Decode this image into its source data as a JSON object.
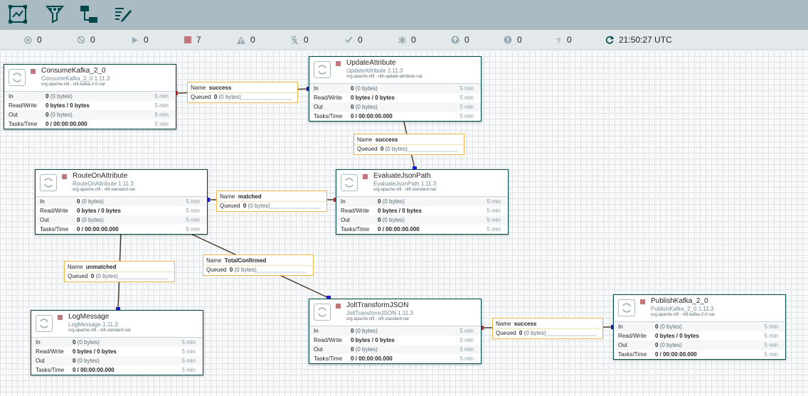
{
  "toolbar": {
    "buttons": [
      {
        "name": "navigate-icon"
      },
      {
        "name": "funnel-icon"
      },
      {
        "name": "connect-icon"
      },
      {
        "name": "edit-icon"
      }
    ]
  },
  "status": {
    "transmitting": "0",
    "not_transmitting": "0",
    "running": "0",
    "stopped": "7",
    "invalid": "0",
    "disabled": "0",
    "up_to_date": "0",
    "locally_modified": "0",
    "stale": "0",
    "sync_failure": "0",
    "unknown": "0",
    "time": "21:50:27 UTC"
  },
  "colors": {
    "stopped": "#c17679",
    "source_port": "#e62727",
    "dest_port": "#1b1bd5",
    "connection_border": "#f0b647",
    "processor_border": "#004849"
  },
  "processors": [
    {
      "id": "consume",
      "name": "ConsumeKafka_2_0",
      "type": "ConsumeKafka_2_0 1.11.3",
      "bundle": "org.apache.nifi - nifi-kafka-2-0-nar",
      "in": "0",
      "in_unit": "(0 bytes)",
      "rw": "0 bytes / 0 bytes",
      "out": "0",
      "out_unit": "(0 bytes)",
      "tasks": "0 / 00:00:00.000",
      "window": "5 min",
      "labels": {
        "in": "In",
        "rw": "Read/Write",
        "out": "Out",
        "tasks": "Tasks/Time"
      }
    },
    {
      "id": "update",
      "name": "UpdateAttribute",
      "type": "UpdateAttribute 1.11.3",
      "bundle": "org.apache.nifi - nifi-update-attribute-nar",
      "in": "0",
      "in_unit": "(0 bytes)",
      "rw": "0 bytes / 0 bytes",
      "out": "0",
      "out_unit": "(0 bytes)",
      "tasks": "0 / 00:00:00.000",
      "window": "5 min",
      "labels": {
        "in": "In",
        "rw": "Read/Write",
        "out": "Out",
        "tasks": "Tasks/Time"
      }
    },
    {
      "id": "route",
      "name": "RouteOnAttribute",
      "type": "RouteOnAttribute 1.11.3",
      "bundle": "org.apache.nifi - nifi-standard-nar",
      "in": "0",
      "in_unit": "(0 bytes)",
      "rw": "0 bytes / 0 bytes",
      "out": "0",
      "out_unit": "(0 bytes)",
      "tasks": "0 / 00:00:00.000",
      "window": "5 min",
      "labels": {
        "in": "In",
        "rw": "Read/Write",
        "out": "Out",
        "tasks": "Tasks/Time"
      }
    },
    {
      "id": "evaluate",
      "name": "EvaluateJsonPath",
      "type": "EvaluateJsonPath 1.11.3",
      "bundle": "org.apache.nifi - nifi-standard-nar",
      "in": "0",
      "in_unit": "(0 bytes)",
      "rw": "0 bytes / 0 bytes",
      "out": "0",
      "out_unit": "(0 bytes)",
      "tasks": "0 / 00:00:00.000",
      "window": "5 min",
      "labels": {
        "in": "In",
        "rw": "Read/Write",
        "out": "Out",
        "tasks": "Tasks/Time"
      }
    },
    {
      "id": "log",
      "name": "LogMessage",
      "type": "LogMessage 1.11.3",
      "bundle": "org.apache.nifi - nifi-standard-nar",
      "in": "0",
      "in_unit": "(0 bytes)",
      "rw": "0 bytes / 0 bytes",
      "out": "0",
      "out_unit": "(0 bytes)",
      "tasks": "0 / 00:00:00.000",
      "window": "5 min",
      "labels": {
        "in": "In",
        "rw": "Read/Write",
        "out": "Out",
        "tasks": "Tasks/Time"
      }
    },
    {
      "id": "jolt",
      "name": "JoltTransformJSON",
      "type": "JoltTransformJSON 1.11.3",
      "bundle": "org.apache.nifi - nifi-standard-nar",
      "in": "0",
      "in_unit": "(0 bytes)",
      "rw": "0 bytes / 0 bytes",
      "out": "0",
      "out_unit": "(0 bytes)",
      "tasks": "0 / 00:00:00.000",
      "window": "5 min",
      "labels": {
        "in": "In",
        "rw": "Read/Write",
        "out": "Out",
        "tasks": "Tasks/Time"
      }
    },
    {
      "id": "publish",
      "name": "PublishKafka_2_0",
      "type": "PublishKafka_2_0 1.11.3",
      "bundle": "org.apache.nifi - nifi-kafka-2-0-nar",
      "in": "0",
      "in_unit": "(0 bytes)",
      "rw": "0 bytes / 0 bytes",
      "out": "0",
      "out_unit": "(0 bytes)",
      "tasks": "0 / 00:00:00.000",
      "window": "5 min",
      "labels": {
        "in": "In",
        "rw": "Read/Write",
        "out": "Out",
        "tasks": "Tasks/Time"
      }
    }
  ],
  "connections": [
    {
      "name_label": "Name",
      "name": "success",
      "queued_label": "Queued",
      "queued": "0",
      "queued_unit": "(0 bytes)"
    },
    {
      "name_label": "Name",
      "name": "success",
      "queued_label": "Queued",
      "queued": "0",
      "queued_unit": "(0 bytes)"
    },
    {
      "name_label": "Name",
      "name": "matched",
      "queued_label": "Queued",
      "queued": "0",
      "queued_unit": "(0 bytes)"
    },
    {
      "name_label": "Name",
      "name": "unmatched",
      "queued_label": "Queued",
      "queued": "0",
      "queued_unit": "(0 bytes)"
    },
    {
      "name_label": "Name",
      "name": "TotalConfirmed",
      "queued_label": "Queued",
      "queued": "0",
      "queued_unit": "(0 bytes)"
    },
    {
      "name_label": "Name",
      "name": "success",
      "queued_label": "Queued",
      "queued": "0",
      "queued_unit": "(0 bytes)"
    }
  ]
}
